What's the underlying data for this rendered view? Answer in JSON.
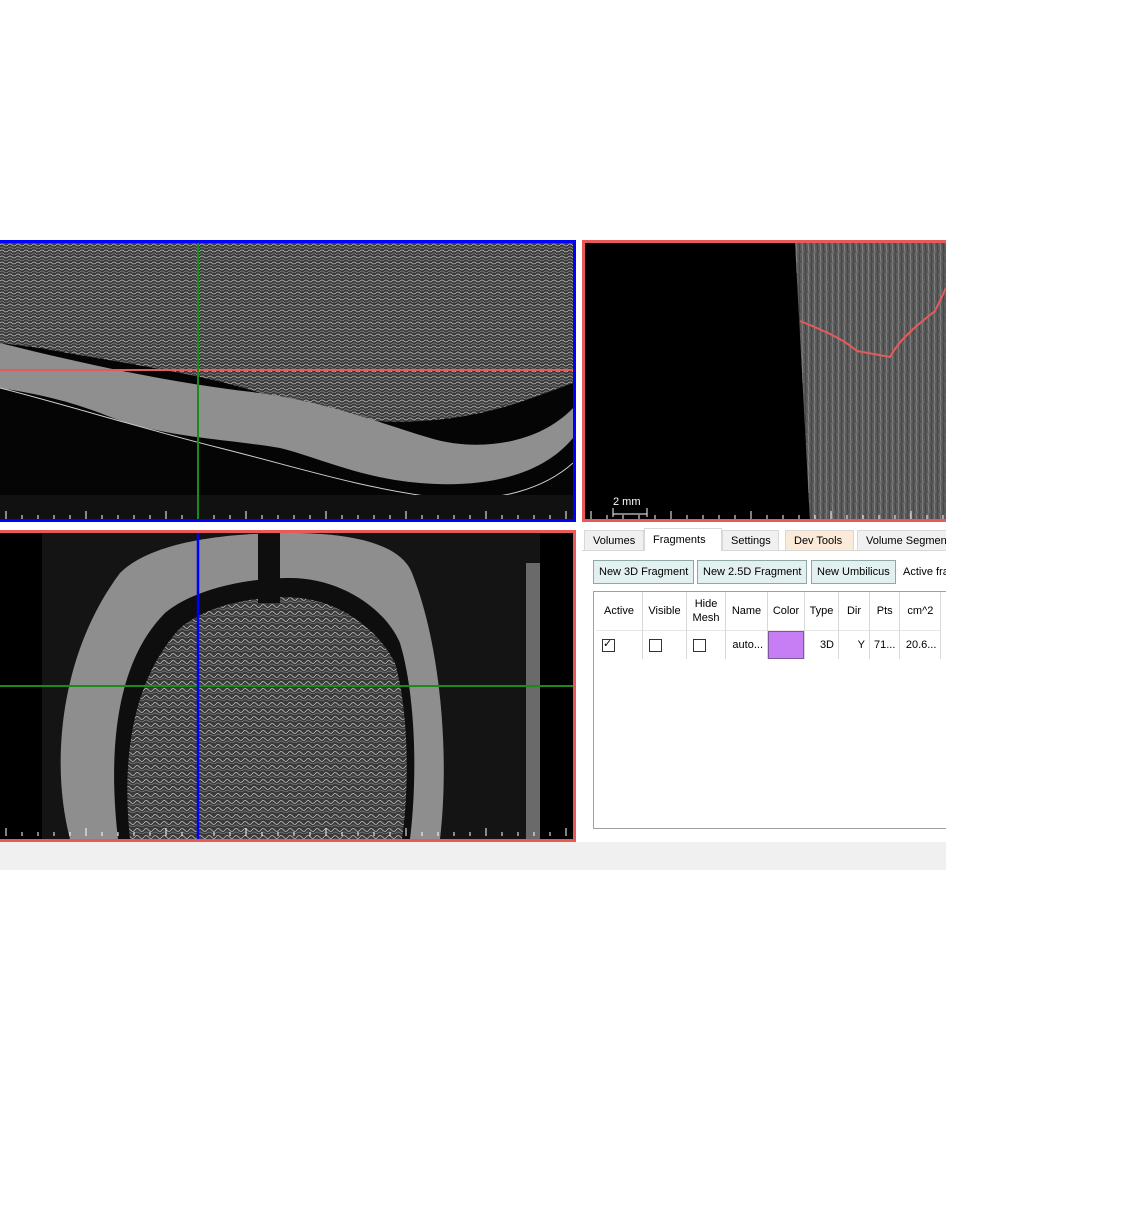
{
  "viewers": {
    "top_right": {
      "scale_label": "2 mm"
    }
  },
  "panel": {
    "tabs": [
      {
        "label": "Volumes"
      },
      {
        "label": "Fragments"
      },
      {
        "label": "Settings"
      },
      {
        "label": "Dev Tools"
      },
      {
        "label": "Volume Segmenta"
      }
    ],
    "active_tab": "Fragments",
    "buttons": {
      "new_3d": "New 3D Fragment",
      "new_25d": "New 2.5D Fragment",
      "new_umbilicus": "New Umbilicus",
      "active_label": "Active fra"
    },
    "table": {
      "headers": [
        "Active",
        "Visible",
        "Hide Mesh",
        "Name",
        "Color",
        "Type",
        "Dir",
        "Pts",
        "cm^2"
      ],
      "rows": [
        {
          "active": true,
          "visible": false,
          "hide_mesh": false,
          "name": "auto...",
          "color": "#c77df3",
          "type": "3D",
          "dir": "Y",
          "pts": "71...",
          "cm2": "20.6..."
        }
      ]
    }
  },
  "colors": {
    "crosshair_red": "#e85a5a",
    "crosshair_green": "#1a8a1a",
    "crosshair_blue": "#0000ff",
    "fragment_line": "#e85a5a"
  }
}
